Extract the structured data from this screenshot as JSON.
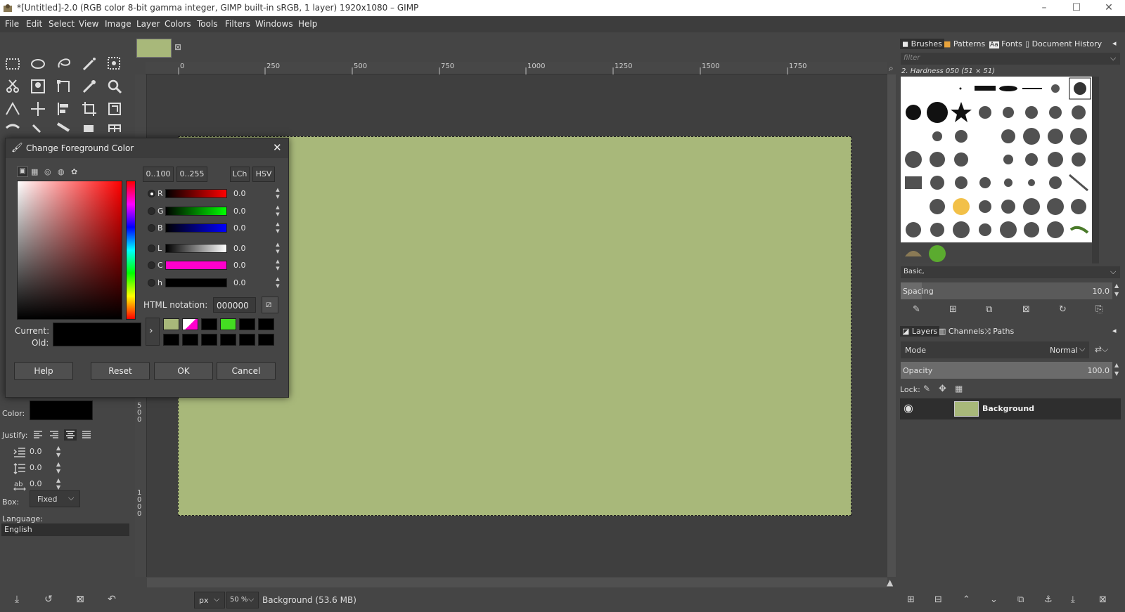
{
  "window": {
    "title": "*[Untitled]-2.0 (RGB color 8-bit gamma integer, GIMP built-in sRGB, 1 layer) 1920x1080 – GIMP",
    "minimize": "–",
    "maximize": "☐",
    "close": "✕"
  },
  "menu": [
    "File",
    "Edit",
    "Select",
    "View",
    "Image",
    "Layer",
    "Colors",
    "Tools",
    "Filters",
    "Windows",
    "Help"
  ],
  "image_tab": {
    "close": "⊠",
    "swatch_color": "#a8b87a"
  },
  "ruler": {
    "h_ticks": [
      "0",
      "250",
      "500",
      "750",
      "1000",
      "1250",
      "1500",
      "1750"
    ],
    "v_ticks": [
      "5",
      "0",
      "0",
      "1",
      "0",
      "0",
      "0"
    ]
  },
  "tool_options": {
    "color_label": "Color:",
    "justify_label": "Justify:",
    "indent_value": "0.0",
    "line_spacing_value": "0.0",
    "letter_spacing_value": "0.0",
    "box_label": "Box:",
    "box_value": "Fixed",
    "language_label": "Language:",
    "language_value": "English"
  },
  "status": {
    "unit": "px",
    "zoom": "50 %",
    "info": "Background (53.6 MB)"
  },
  "dock_top": {
    "tabs": [
      "Brushes",
      "Patterns",
      "Fonts",
      "Document History"
    ],
    "filter_placeholder": "filter",
    "brush_name": "2. Hardness 050 (51 × 51)",
    "preset": "Basic,",
    "spacing_label": "Spacing",
    "spacing_value": "10.0"
  },
  "dock_bottom": {
    "tabs": [
      "Layers",
      "Channels",
      "Paths"
    ],
    "mode_label": "Mode",
    "mode_value": "Normal",
    "opacity_label": "Opacity",
    "opacity_value": "100.0",
    "lock_label": "Lock:",
    "layer_name": "Background",
    "layer_color": "#a8b87a"
  },
  "dialog": {
    "title": "Change Foreground Color",
    "range_buttons": [
      "0..100",
      "0..255"
    ],
    "model_buttons": [
      "LCh",
      "HSV"
    ],
    "channels": [
      {
        "name": "R",
        "value": "0.0",
        "selected": true
      },
      {
        "name": "G",
        "value": "0.0",
        "selected": false
      },
      {
        "name": "B",
        "value": "0.0",
        "selected": false
      },
      {
        "name": "L",
        "value": "0.0",
        "selected": false
      },
      {
        "name": "C",
        "value": "0.0",
        "selected": false
      },
      {
        "name": "h",
        "value": "0.0",
        "selected": false
      }
    ],
    "html_label": "HTML notation:",
    "html_value": "000000",
    "current_label": "Current:",
    "old_label": "Old:",
    "current_color": "#000000",
    "history_colors": [
      "#a8b87a",
      "#ffffff",
      "#000000",
      "#44dd22",
      "#000000",
      "#000000",
      "#000000",
      "#000000",
      "#000000",
      "#000000",
      "#000000",
      "#000000"
    ],
    "buttons": {
      "help": "Help",
      "reset": "Reset",
      "ok": "OK",
      "cancel": "Cancel"
    }
  }
}
